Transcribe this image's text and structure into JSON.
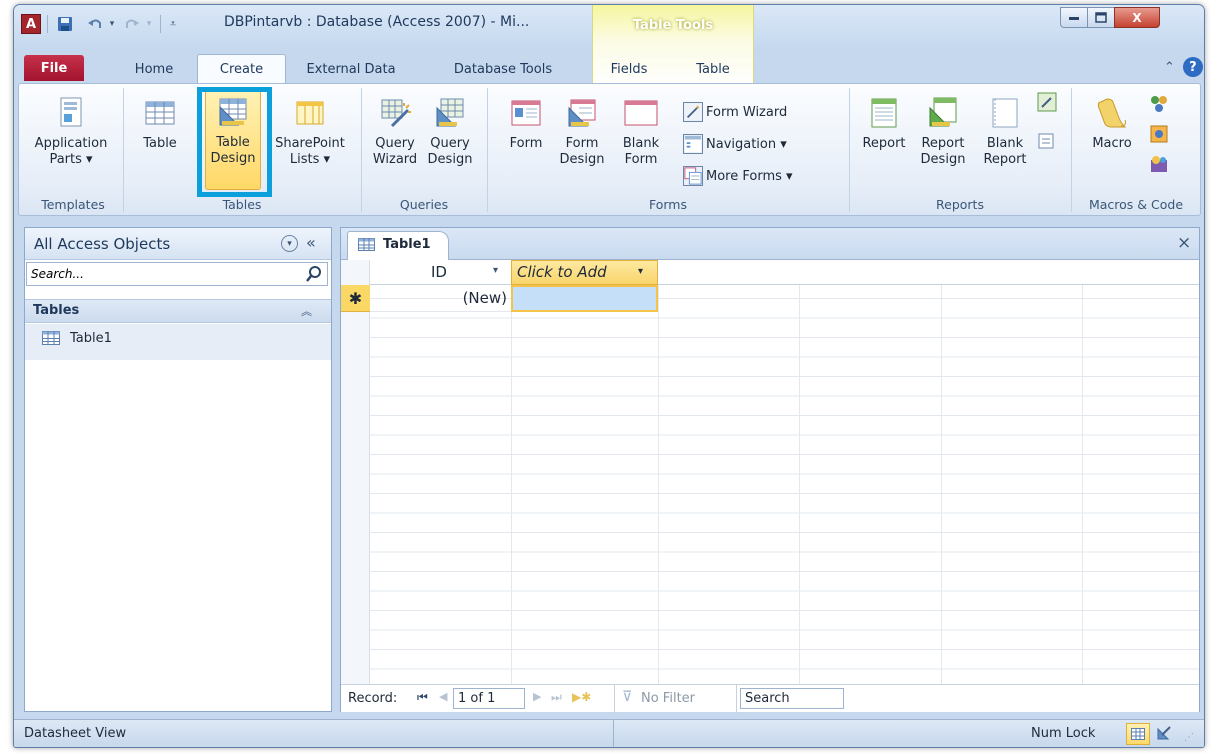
{
  "window": {
    "app_icon_letter": "A",
    "title": "DBPintarvb : Database (Access 2007) - Mi...",
    "contextual_tab_title": "Table Tools",
    "min_label": "▭",
    "max_label": "▢",
    "close_label": "X"
  },
  "tabs": [
    {
      "label": "File"
    },
    {
      "label": "Home"
    },
    {
      "label": "Create"
    },
    {
      "label": "External Data"
    },
    {
      "label": "Database Tools"
    },
    {
      "label": "Fields"
    },
    {
      "label": "Table"
    }
  ],
  "ribbon": {
    "templates": {
      "label": "Templates",
      "app_parts_line1": "Application",
      "app_parts_line2": "Parts ▾"
    },
    "tables": {
      "label": "Tables",
      "table": "Table",
      "table_design_line1": "Table",
      "table_design_line2": "Design",
      "sharepoint_line1": "SharePoint",
      "sharepoint_line2": "Lists ▾"
    },
    "queries": {
      "label": "Queries",
      "wizard_line1": "Query",
      "wizard_line2": "Wizard",
      "design_line1": "Query",
      "design_line2": "Design"
    },
    "forms": {
      "label": "Forms",
      "form": "Form",
      "form_design_line1": "Form",
      "form_design_line2": "Design",
      "blank_form_line1": "Blank",
      "blank_form_line2": "Form",
      "form_wizard": "Form Wizard",
      "navigation": "Navigation ▾",
      "more_forms": "More Forms ▾"
    },
    "reports": {
      "label": "Reports",
      "report": "Report",
      "report_design_line1": "Report",
      "report_design_line2": "Design",
      "blank_report_line1": "Blank",
      "blank_report_line2": "Report"
    },
    "macros": {
      "label": "Macros & Code",
      "macro": "Macro"
    }
  },
  "nav_pane": {
    "title": "All Access Objects",
    "search_placeholder": "Search...",
    "group": "Tables",
    "items": [
      {
        "label": "Table1"
      }
    ]
  },
  "document": {
    "tab_label": "Table1",
    "close_label": "×",
    "columns": [
      {
        "label": "ID"
      },
      {
        "label": "Click to Add"
      }
    ],
    "new_row_marker": "✱",
    "new_row_id": "(New)"
  },
  "record_nav": {
    "label": "Record:",
    "position": "1 of 1",
    "filter": "No Filter",
    "search": "Search"
  },
  "status": {
    "view": "Datasheet View",
    "num_lock": "Num Lock"
  },
  "colors": {
    "accent": "#0ba0dc",
    "file_tab": "#a2132e",
    "selection": "#ffd867"
  }
}
